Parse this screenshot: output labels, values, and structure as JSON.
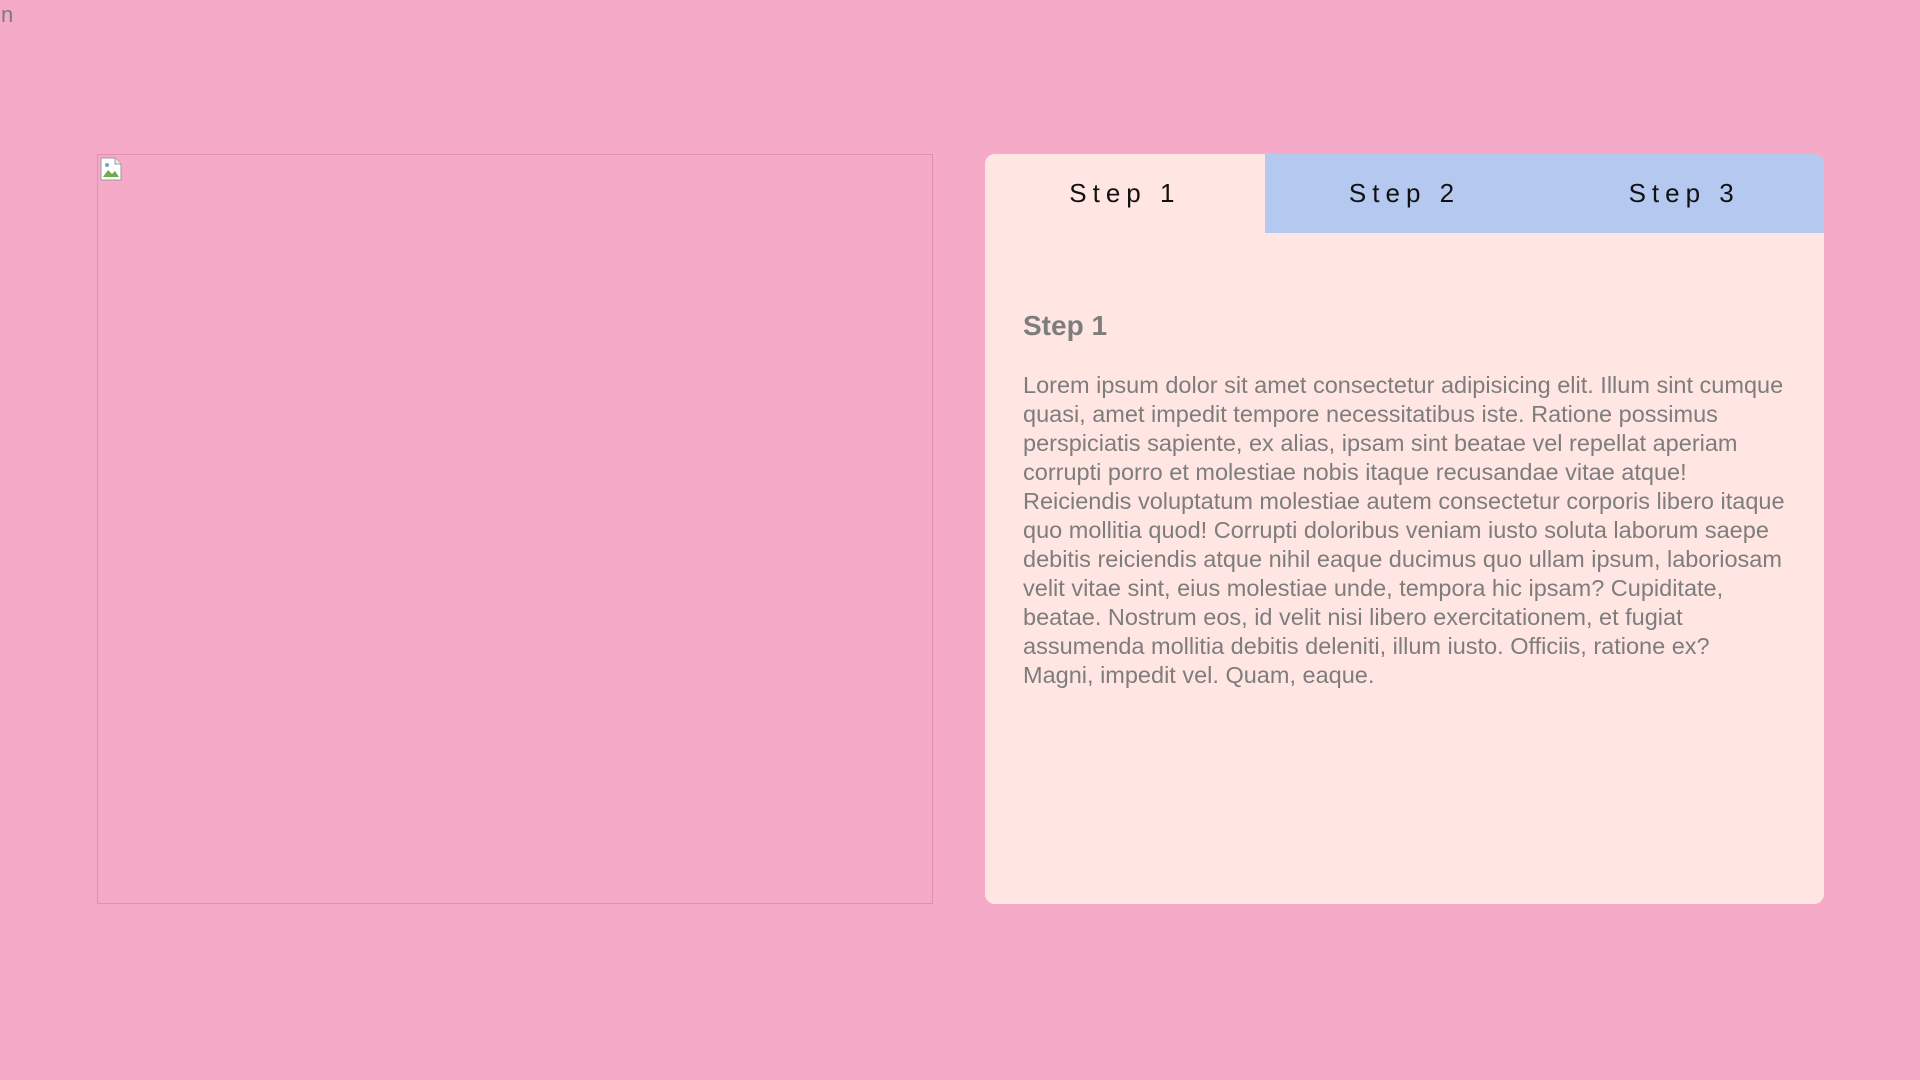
{
  "corner_text": "n",
  "tabs": [
    {
      "label": "Step 1"
    },
    {
      "label": "Step 2"
    },
    {
      "label": "Step 3"
    }
  ],
  "active_tab": 0,
  "panel": {
    "title": "Step 1",
    "body": "Lorem ipsum dolor sit amet consectetur adipisicing elit. Illum sint cumque quasi, amet impedit tempore necessitatibus iste. Ratione possimus perspiciatis sapiente, ex alias, ipsam sint beatae vel repellat aperiam corrupti porro et molestiae nobis itaque recusandae vitae atque! Reiciendis voluptatum molestiae autem consectetur corporis libero itaque quo mollitia quod! Corrupti doloribus veniam iusto soluta laborum saepe debitis reiciendis atque nihil eaque ducimus quo ullam ipsum, laboriosam velit vitae sint, eius molestiae unde, tempora hic ipsam? Cupiditate, beatae. Nostrum eos, id velit nisi libero exercitationem, et fugiat assumenda mollitia debitis deleniti, illum iusto. Officiis, ratione ex? Magni, impedit vel. Quam, eaque."
  },
  "colors": {
    "background": "#f5aac8",
    "card": "#ffe6e2",
    "tab_inactive": "#b4c8f0",
    "text_muted": "#7d7d7d"
  }
}
